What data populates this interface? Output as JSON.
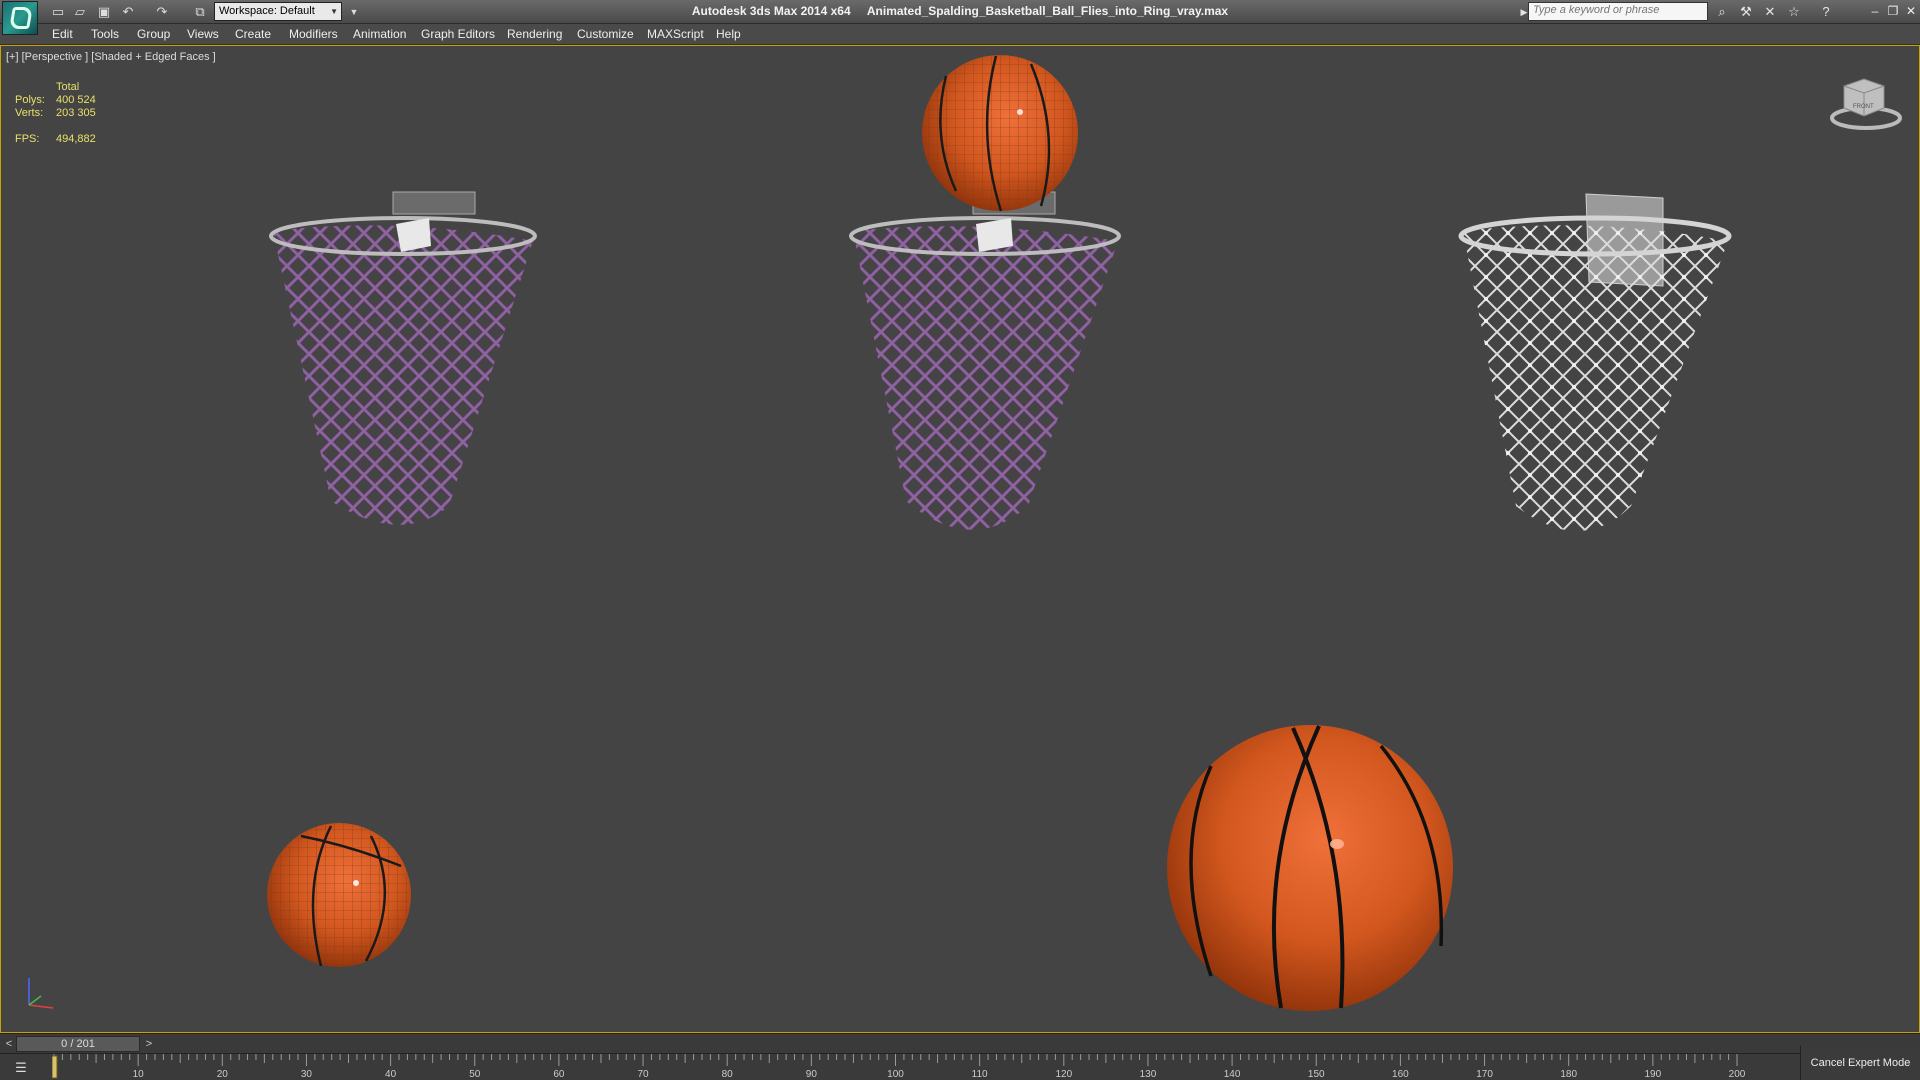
{
  "titlebar": {
    "app_name": "Autodesk 3ds Max  2014 x64",
    "file_name": "Animated_Spalding_Basketball_Ball_Flies_into_Ring_vray.max",
    "workspace_label": "Workspace: Default",
    "search_placeholder": "Type a keyword or phrase",
    "icons": [
      "new-file-icon",
      "open-file-icon",
      "save-icon",
      "undo-icon",
      "redo-icon",
      "project-folder-icon",
      "binoculars-icon",
      "tools-icon",
      "exchange-icon",
      "favorites-star-icon",
      "help-icon"
    ]
  },
  "menubar": {
    "items": [
      "Edit",
      "Tools",
      "Group",
      "Views",
      "Create",
      "Modifiers",
      "Animation",
      "Graph Editors",
      "Rendering",
      "Customize",
      "MAXScript",
      "Help"
    ]
  },
  "viewport": {
    "label": "[+] [Perspective ] [Shaded + Edged Faces ]",
    "stats": {
      "header": "Total",
      "polys_label": "Polys:",
      "polys_value": "400 524",
      "verts_label": "Verts:",
      "verts_value": "203 305",
      "fps_label": "FPS:",
      "fps_value": "494,882"
    },
    "viewcube_label": "FRONT",
    "colors": {
      "background": "#444444",
      "ball_orange": "#d2571e",
      "net_purple": "#9a4fb8",
      "net_white": "#dcdcdc",
      "rim_grey": "#bdbdbd",
      "active_border": "#c9a200",
      "stats_text": "#e9e06a"
    }
  },
  "timeline": {
    "frame_indicator": "0 / 201",
    "prev_label": "<",
    "next_label": ">",
    "ticks": [
      "0",
      "10",
      "20",
      "30",
      "40",
      "50",
      "60",
      "70",
      "80",
      "90",
      "100",
      "110",
      "120",
      "130",
      "140",
      "150",
      "160",
      "170",
      "180",
      "190",
      "200"
    ],
    "frame_total": 201,
    "current_frame": 0
  },
  "statusbar": {
    "cancel_expert": "Cancel Expert Mode"
  }
}
